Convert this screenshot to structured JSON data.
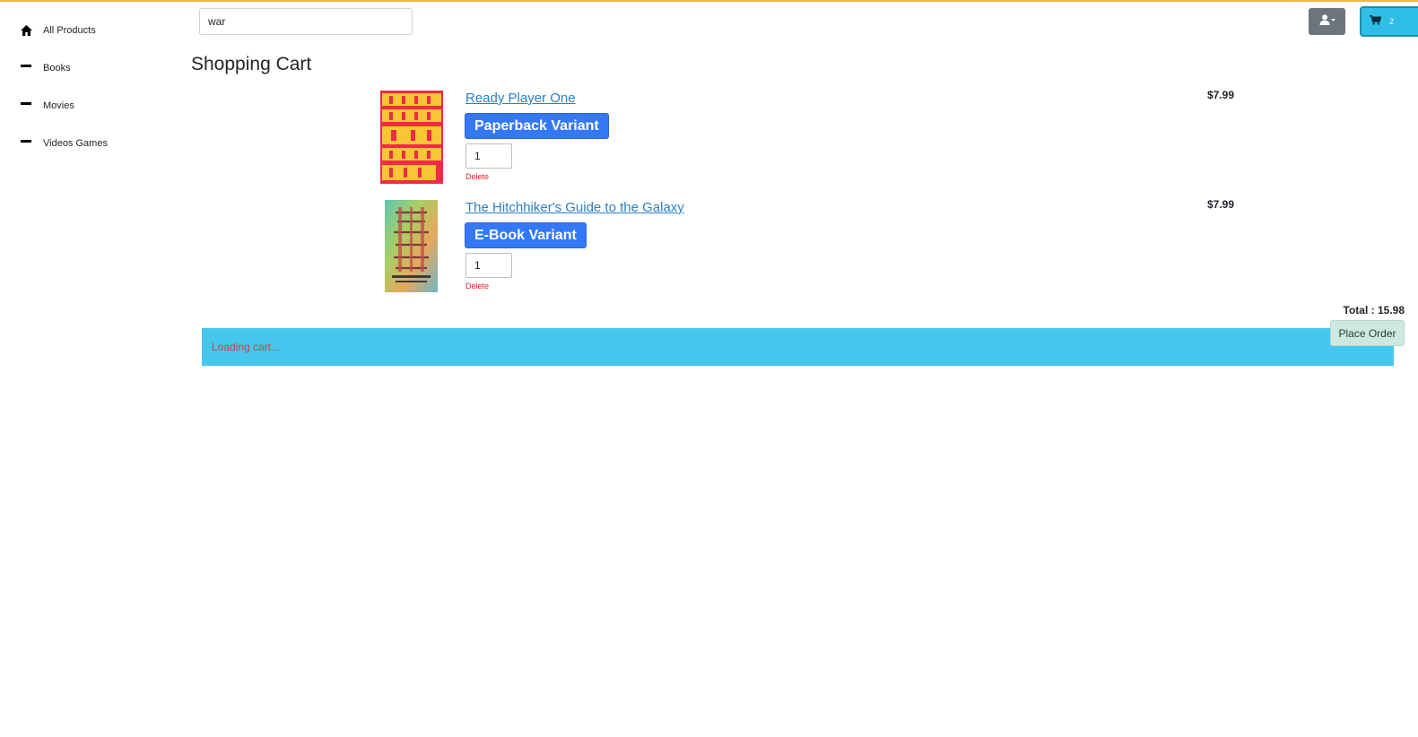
{
  "sidebar": {
    "items": [
      {
        "label": "All Products",
        "icon": "home-icon"
      },
      {
        "label": "Books",
        "icon": "dash-icon"
      },
      {
        "label": "Movies",
        "icon": "dash-icon"
      },
      {
        "label": "Videos Games",
        "icon": "dash-icon"
      }
    ]
  },
  "search": {
    "value": "war",
    "placeholder": ""
  },
  "header": {
    "user_icon": "user-icon",
    "cart_icon": "cart-icon",
    "cart_count": "2"
  },
  "page": {
    "title": "Shopping Cart"
  },
  "cart": {
    "items": [
      {
        "title": "Ready Player One",
        "variant": "Paperback Variant",
        "quantity": "1",
        "delete_label": "Delete",
        "price": "$7.99"
      },
      {
        "title": "The Hitchhiker's Guide to the Galaxy",
        "variant": "E-Book Variant",
        "quantity": "1",
        "delete_label": "Delete",
        "price": "$7.99"
      }
    ],
    "total_label": "Total : 15.98",
    "place_order_label": "Place Order",
    "status_message": "Loading cart..."
  },
  "colors": {
    "accent_blue": "#3478f6",
    "link_blue": "#2a7fc4",
    "cart_button": "#2fbfe6",
    "status_bar": "#45c6ec",
    "delete_red": "#e0242e",
    "top_border": "#f0b94a"
  }
}
